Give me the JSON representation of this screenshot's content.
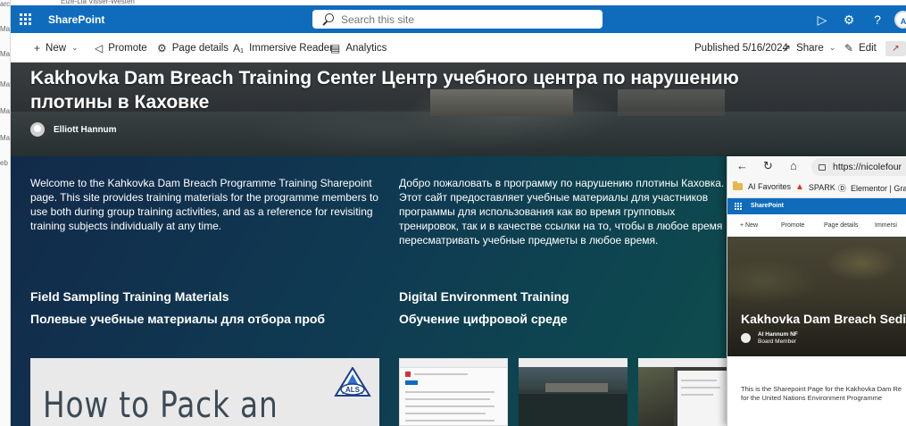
{
  "background_window": {
    "top_text": "Elze-Lia Visser-Westen",
    "left_fragments": [
      "arch 18",
      "Ma",
      "Ma",
      "Ma",
      "Ma",
      "Ma",
      "eb"
    ]
  },
  "suite_bar": {
    "app_name": "SharePoint",
    "search_placeholder": "Search this site",
    "icons": [
      "waffle-icon",
      "feedback-icon",
      "settings-icon",
      "help-icon"
    ],
    "avatar_initials": "A",
    "color": "#0f6cbd"
  },
  "command_bar": {
    "new": "New",
    "promote": "Promote",
    "page_details": "Page details",
    "immersive_reader": "Immersive Reader",
    "analytics": "Analytics",
    "published": "Published 5/16/2024",
    "share": "Share",
    "edit": "Edit"
  },
  "hero": {
    "title": "Kakhovka Dam Breach Training Center Центр учебного центра по нарушению плотины в Каховке",
    "author": "Elliott Hannum"
  },
  "intro": {
    "en": "Welcome to the Kahkovka Dam Breach Programme Training Sharepoint page. This site provides training materials for the programme members to use both during group training activities, and as a reference for revisiting training subjects individually at any time.",
    "ru": "Добро пожаловать в программу по нарушению плотины Каховка. Этот сайт предоставляет учебные материалы для участников программы для использования как во время групповых тренировок, так и в качестве ссылки на то, чтобы в любое время пересматривать учебные предметы в любое время."
  },
  "sections": {
    "field_en": "Field Sampling Training Materials",
    "field_ru": "Полевые учебные материалы для отбора проб",
    "digital_en": "Digital Environment Training",
    "digital_ru": "Обучение цифровой среде"
  },
  "thumbnails": {
    "pack_title": "How to Pack an",
    "als_logo_text": "ALS"
  },
  "overlay_browser": {
    "url": "https://nicolefour",
    "favorites": [
      "AI Favorites",
      "SPARK",
      "Elementor | Grac"
    ],
    "app_name": "SharePoint",
    "commands": [
      "+ New",
      "Promote",
      "Page details",
      "Immersi"
    ],
    "hero_title": "Kakhovka Dam Breach Sedim",
    "author_name": "Al Hannum NF",
    "author_role": "Board Member",
    "body": "This is the Sharepoint Page for the Kakhovka Dam Re for the United Nations Environment Programme"
  }
}
